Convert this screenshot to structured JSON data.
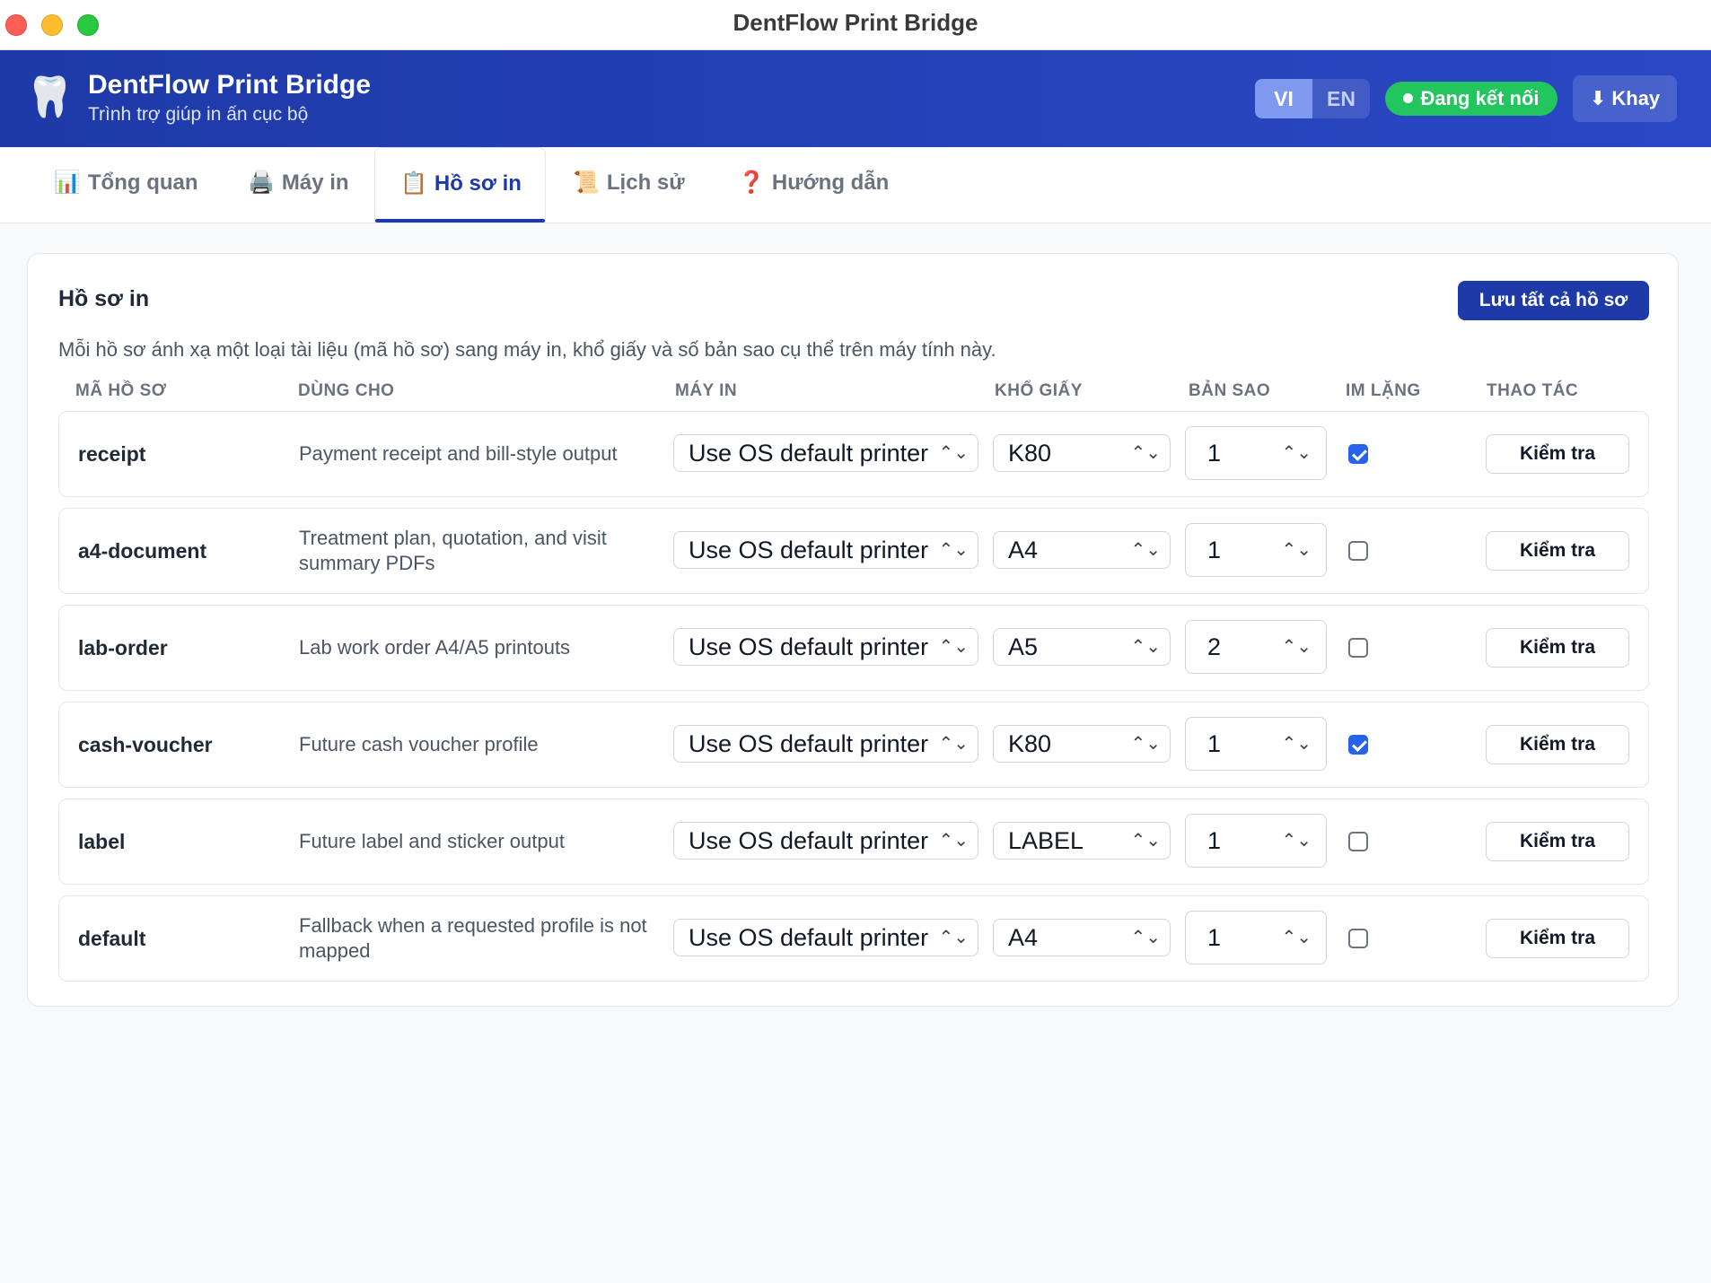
{
  "window": {
    "title": "DentFlow Print Bridge"
  },
  "header": {
    "logo_icon": "tooth-icon",
    "app_name": "DentFlow Print Bridge",
    "subtitle": "Trình trợ giúp in ấn cục bộ",
    "languages": [
      "VI",
      "EN"
    ],
    "active_language": "VI",
    "status": "Đang kết nối",
    "status_color": "#22c55e",
    "tray_label": "⬇ Khay",
    "brand_color": "#1e3aa8"
  },
  "tabs": [
    {
      "icon": "📊",
      "label": "Tổng quan"
    },
    {
      "icon": "🖨️",
      "label": "Máy in"
    },
    {
      "icon": "📋",
      "label": "Hồ sơ in"
    },
    {
      "icon": "📜",
      "label": "Lịch sử"
    },
    {
      "icon": "❓",
      "label": "Hướng dẫn"
    }
  ],
  "active_tab": "Hồ sơ in",
  "profiles": {
    "title": "Hồ sơ in",
    "save_all_label": "Lưu tất cả hồ sơ",
    "description": "Mỗi hồ sơ ánh xạ một loại tài liệu (mã hồ sơ) sang máy in, khổ giấy và số bản sao cụ thể trên máy tính này.",
    "columns": {
      "code": "MÃ HỒ SƠ",
      "usage": "DÙNG CHO",
      "printer": "MÁY IN",
      "paper": "KHỔ GIẤY",
      "copies": "BẢN SAO",
      "silent": "IM LẶNG",
      "action": "THAO TÁC"
    },
    "rows": [
      {
        "code": "receipt",
        "usage": "Payment receipt and bill-style output",
        "printer": "Use OS default printer",
        "paper": "K80",
        "copies": "1",
        "silent": true,
        "action": "Kiểm tra"
      },
      {
        "code": "a4-document",
        "usage": "Treatment plan, quotation, and visit summary PDFs",
        "printer": "Use OS default printer",
        "paper": "A4",
        "copies": "1",
        "silent": false,
        "action": "Kiểm tra"
      },
      {
        "code": "lab-order",
        "usage": "Lab work order A4/A5 printouts",
        "printer": "Use OS default printer",
        "paper": "A5",
        "copies": "2",
        "silent": false,
        "action": "Kiểm tra"
      },
      {
        "code": "cash-voucher",
        "usage": "Future cash voucher profile",
        "printer": "Use OS default printer",
        "paper": "K80",
        "copies": "1",
        "silent": true,
        "action": "Kiểm tra"
      },
      {
        "code": "label",
        "usage": "Future label and sticker output",
        "printer": "Use OS default printer",
        "paper": "LABEL",
        "copies": "1",
        "silent": false,
        "action": "Kiểm tra"
      },
      {
        "code": "default",
        "usage": "Fallback when a requested profile is not mapped",
        "printer": "Use OS default printer",
        "paper": "A4",
        "copies": "1",
        "silent": false,
        "action": "Kiểm tra"
      }
    ]
  }
}
